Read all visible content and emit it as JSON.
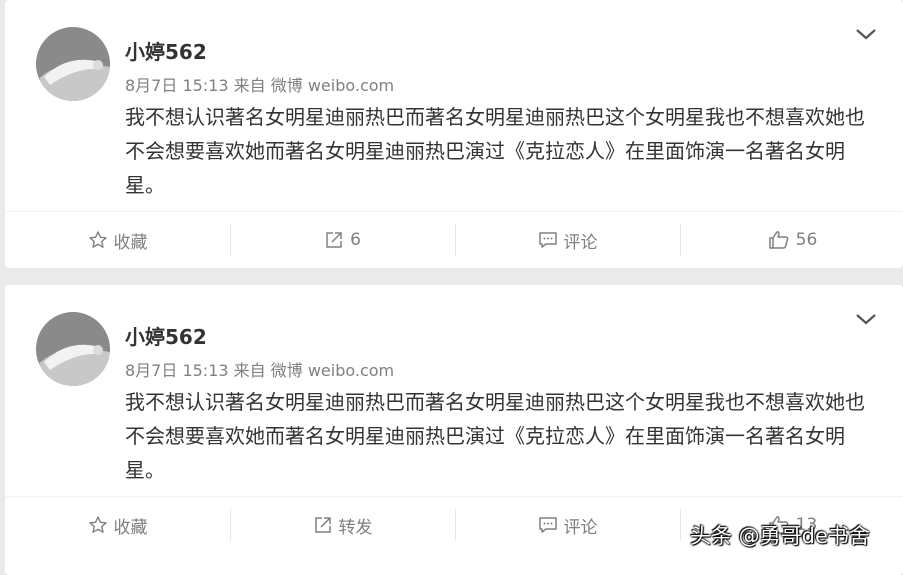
{
  "posts": [
    {
      "username": "小婷562",
      "meta": "8月7日 15:13 来自 微博 weibo.com",
      "text": "我不想认识著名女明星迪丽热巴而著名女明星迪丽热巴这个女明星我也不想喜欢她也不会想要喜欢她而著名女明星迪丽热巴演过《克拉恋人》在里面饰演一名著名女明星。",
      "actions": {
        "favorite": "收藏",
        "repost": "6",
        "comment": "评论",
        "like": "56"
      }
    },
    {
      "username": "小婷562",
      "meta": "8月7日 15:13 来自 微博 weibo.com",
      "text": "我不想认识著名女明星迪丽热巴而著名女明星迪丽热巴这个女明星我也不想喜欢她也不会想要喜欢她而著名女明星迪丽热巴演过《克拉恋人》在里面饰演一名著名女明星。",
      "actions": {
        "favorite": "收藏",
        "repost": "转发",
        "comment": "评论",
        "like": "13"
      }
    }
  ],
  "watermark": "头条 @勇哥de书舍",
  "icons": {
    "favorite": "star-icon",
    "repost": "share-icon",
    "comment": "comment-icon",
    "like": "thumbs-up-icon",
    "menu": "chevron-down-icon"
  },
  "colors": {
    "background": "#eaeaea",
    "card": "#ffffff",
    "text": "#333333",
    "secondary": "#808080"
  }
}
